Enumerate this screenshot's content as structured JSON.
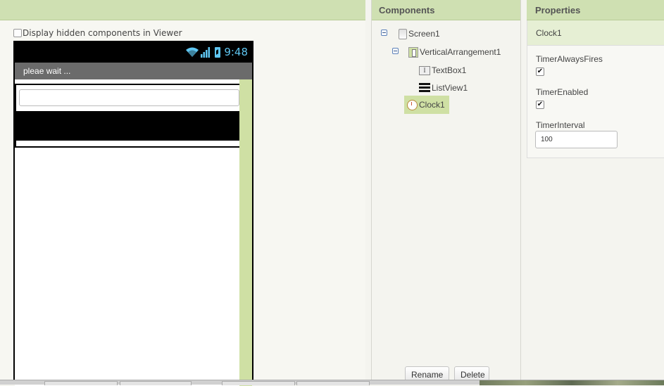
{
  "viewer": {
    "hidden_components_label": "Display hidden components in Viewer",
    "phone": {
      "status_time": "9:48",
      "screen_title": "pleae wait ...",
      "textbox_value": ""
    }
  },
  "components": {
    "header": "Components",
    "tree": [
      {
        "label": "Screen1",
        "icon": "screen-icon",
        "collapsible": true
      },
      {
        "label": "VerticalArrangement1",
        "icon": "vertical-arrangement-icon",
        "collapsible": true
      },
      {
        "label": "TextBox1",
        "icon": "textbox-icon"
      },
      {
        "label": "ListView1",
        "icon": "listview-icon"
      },
      {
        "label": "Clock1",
        "icon": "clock-icon",
        "selected": true
      }
    ],
    "rename_label": "Rename",
    "delete_label": "Delete"
  },
  "properties": {
    "header": "Properties",
    "component_name": "Clock1",
    "items": [
      {
        "label": "TimerAlwaysFires",
        "type": "checkbox",
        "checked": true,
        "mark": "✔"
      },
      {
        "label": "TimerEnabled",
        "type": "checkbox",
        "checked": true,
        "mark": "✔"
      },
      {
        "label": "TimerInterval",
        "type": "text",
        "value": "100"
      }
    ]
  },
  "colors": {
    "header_green": "#cfe0b2",
    "selection_green": "#cfe0a4",
    "status_blue": "#5fc6f1"
  }
}
